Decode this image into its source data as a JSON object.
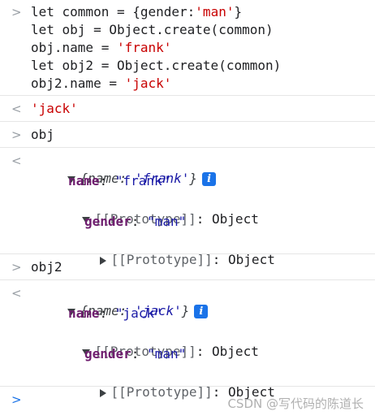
{
  "console": {
    "input1": {
      "lines": [
        {
          "a": "let common = {gender:",
          "b": "'man'",
          "c": "}"
        },
        {
          "a": "let obj = Object.create(common)",
          "b": "",
          "c": ""
        },
        {
          "a": "obj.name = ",
          "b": "'frank'",
          "c": ""
        },
        {
          "a": "let obj2 = Object.create(common)",
          "b": "",
          "c": ""
        },
        {
          "a": "obj2.name = ",
          "b": "'jack'",
          "c": ""
        }
      ]
    },
    "result1": "'jack'",
    "input2": "obj",
    "obj_output": {
      "preview_open": "{name: ",
      "preview_value": "'frank'",
      "preview_close": "}",
      "info_icon": "i",
      "name_key": "name",
      "name_value": "\"frank\"",
      "proto_label": "[[Prototype]]",
      "proto_value": "Object",
      "gender_key": "gender",
      "gender_value": "\"man\"",
      "inner_proto_label": "[[Prototype]]",
      "inner_proto_value": "Object"
    },
    "input3": "obj2",
    "obj2_output": {
      "preview_open": "{name: ",
      "preview_value": "'jack'",
      "preview_close": "}",
      "info_icon": "i",
      "name_key": "name",
      "name_value": "\"jack\"",
      "proto_label": "[[Prototype]]",
      "proto_value": "Object",
      "gender_key": "gender",
      "gender_value": "\"man\"",
      "inner_proto_label": "[[Prototype]]",
      "inner_proto_value": "Object"
    },
    "glyphs": {
      "prompt": ">",
      "result": "<"
    }
  },
  "watermark": "CSDN @写代码的陈道长"
}
